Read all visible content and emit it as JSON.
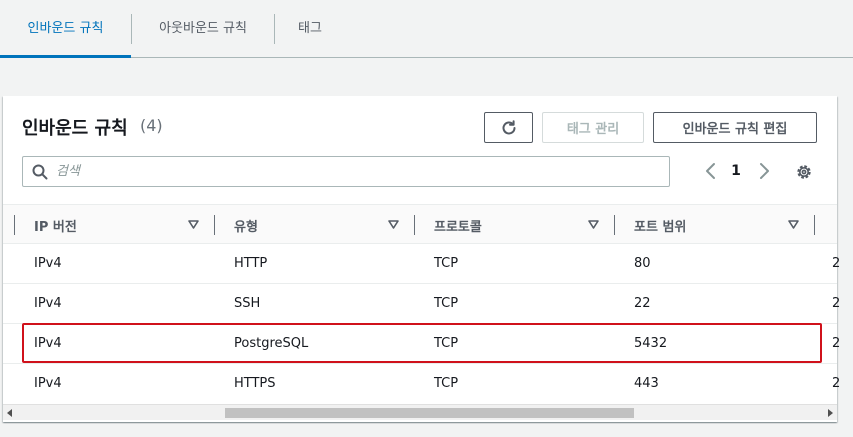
{
  "tabs": [
    {
      "label": "인바운드 규칙"
    },
    {
      "label": "아웃바운드 규칙"
    },
    {
      "label": "태그"
    }
  ],
  "panel": {
    "title": "인바운드 규칙",
    "count": "(4)",
    "buttons": {
      "manage_tags": "태그 관리",
      "edit_rules": "인바운드 규칙 편집"
    }
  },
  "search": {
    "placeholder": "검색",
    "value": ""
  },
  "pagination": {
    "current_page": "1"
  },
  "table": {
    "columns": [
      "IP 버전",
      "유형",
      "프로토콜",
      "포트 범위"
    ],
    "rows": [
      {
        "ip_version": "IPv4",
        "type": "HTTP",
        "protocol": "TCP",
        "port_range": "80",
        "next_col": "2"
      },
      {
        "ip_version": "IPv4",
        "type": "SSH",
        "protocol": "TCP",
        "port_range": "22",
        "next_col": "2"
      },
      {
        "ip_version": "IPv4",
        "type": "PostgreSQL",
        "protocol": "TCP",
        "port_range": "5432",
        "next_col": "2"
      },
      {
        "ip_version": "IPv4",
        "type": "HTTPS",
        "protocol": "TCP",
        "port_range": "443",
        "next_col": "2"
      }
    ],
    "highlighted_row": 2
  },
  "colors": {
    "accent": "#0073bb",
    "highlight": "#d0111b"
  },
  "icons": [
    "refresh-icon",
    "search-icon",
    "chevron-left-icon",
    "chevron-right-icon",
    "gear-icon",
    "sort-caret-icon"
  ]
}
